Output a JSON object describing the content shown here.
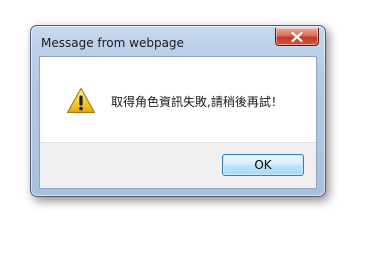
{
  "dialog": {
    "title": "Message from webpage",
    "message": "取得角色資訊失敗,請稍後再試！",
    "ok_label": "OK",
    "icon": "warning-icon",
    "close_icon": "close-icon"
  },
  "colors": {
    "frame": "#bcd1ea",
    "close_button": "#c23a22",
    "button_area": "#f0f0f0",
    "ok_button_border": "#3c7fb1",
    "warning_yellow": "#f5c518"
  }
}
